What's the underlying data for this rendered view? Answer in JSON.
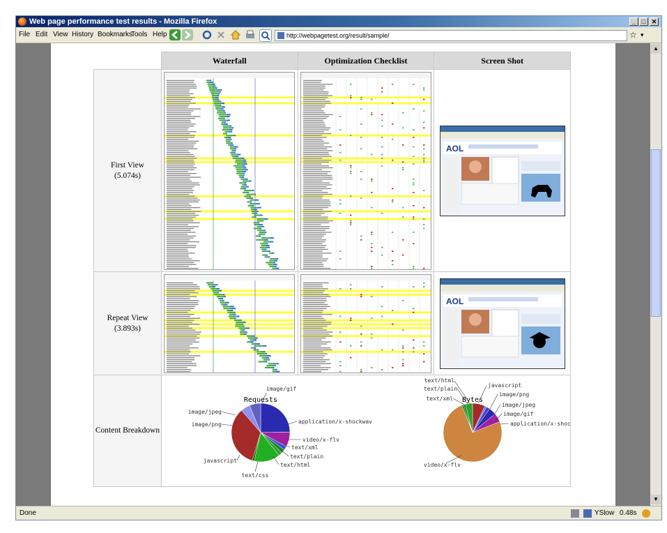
{
  "window": {
    "title": "Web page performance test results - Mozilla Firefox"
  },
  "menu": [
    "File",
    "Edit",
    "View",
    "History",
    "Bookmarks",
    "Tools",
    "Help"
  ],
  "url": "http://webpagetest.org/result/sample/",
  "status": {
    "text": "Done",
    "yslow": "YSlow",
    "time": "0.48s"
  },
  "table": {
    "headers": [
      "Waterfall",
      "Optimization Checklist",
      "Screen Shot"
    ],
    "rows": [
      {
        "label": "First View",
        "time": "(5.074s)"
      },
      {
        "label": "Repeat View",
        "time": "(3.893s)"
      }
    ],
    "breakdown_label": "Content Breakdown"
  },
  "screenshot_texts": {
    "logo": "AOL"
  },
  "colors": {
    "pie_red": "#a52a2a",
    "pie_blue": "#2a2ab0",
    "pie_lightblue": "#8a8af0",
    "pie_purple": "#a020a0",
    "pie_green": "#2aa52a",
    "pie_tan": "#cd853f",
    "highlight": "#ffff33"
  },
  "chart_data": [
    {
      "type": "pie",
      "title": "Requests",
      "categories": [
        "image/gif",
        "application/x-shockwav",
        "video/x-flv",
        "text/xml",
        "text/plain",
        "text/html",
        "text/css",
        "javascript",
        "image/png",
        "image/jpeg"
      ],
      "values": [
        24,
        8,
        2,
        2,
        2,
        14,
        1,
        33,
        5,
        6
      ],
      "colors": [
        "#2a2ab0",
        "#a020a0",
        "#3050e0",
        "#208020",
        "#30a030",
        "#22b022",
        "#0a5a0a",
        "#a52a2a",
        "#9090f0",
        "#6060c0"
      ]
    },
    {
      "type": "pie",
      "title": "Bytes",
      "categories": [
        "javascript",
        "image/png",
        "image/jpeg",
        "image/gif",
        "application/x-shocku",
        "video/x-flv",
        "text/xml",
        "text/plain",
        "text/html"
      ],
      "values": [
        7,
        1,
        2,
        4,
        5,
        75,
        1,
        1,
        4
      ],
      "colors": [
        "#a52a2a",
        "#7070f0",
        "#4040c0",
        "#2a2ab0",
        "#a020a0",
        "#cd853f",
        "#208020",
        "#0a6a0a",
        "#2aa52a"
      ]
    }
  ]
}
